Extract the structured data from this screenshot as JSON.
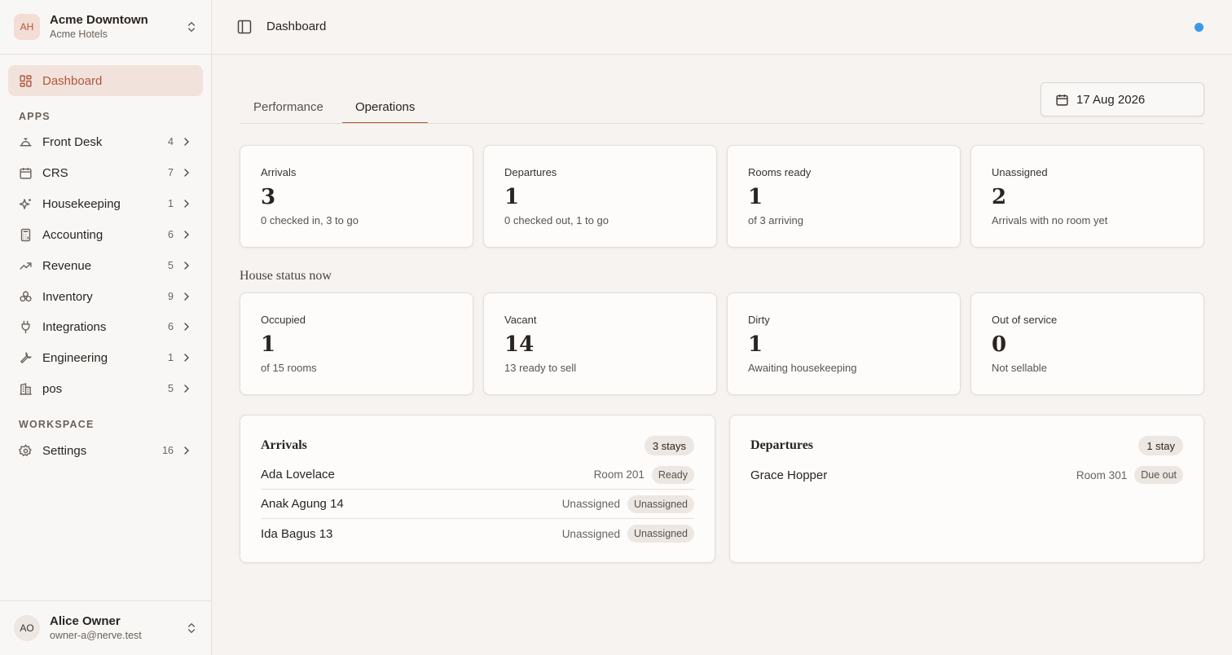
{
  "org": {
    "initials": "AH",
    "name": "Acme Downtown",
    "company": "Acme Hotels"
  },
  "nav": {
    "dashboard": "Dashboard",
    "apps_heading": "APPS",
    "apps": [
      {
        "label": "Front Desk",
        "count": "4",
        "icon": "bell-icon"
      },
      {
        "label": "CRS",
        "count": "7",
        "icon": "calendar-icon"
      },
      {
        "label": "Housekeeping",
        "count": "1",
        "icon": "sparkles-icon"
      },
      {
        "label": "Accounting",
        "count": "6",
        "icon": "calculator-icon"
      },
      {
        "label": "Revenue",
        "count": "5",
        "icon": "trending-up-icon"
      },
      {
        "label": "Inventory",
        "count": "9",
        "icon": "boxes-icon"
      },
      {
        "label": "Integrations",
        "count": "6",
        "icon": "plug-icon"
      },
      {
        "label": "Engineering",
        "count": "1",
        "icon": "wrench-icon"
      },
      {
        "label": "pos",
        "count": "5",
        "icon": "building-icon"
      }
    ],
    "workspace_heading": "WORKSPACE",
    "settings": {
      "label": "Settings",
      "count": "16",
      "icon": "gear-icon"
    }
  },
  "user": {
    "initials": "AO",
    "name": "Alice Owner",
    "email": "owner-a@nerve.test"
  },
  "topbar": {
    "breadcrumb": "Dashboard"
  },
  "tabs": [
    {
      "label": "Performance",
      "active": false
    },
    {
      "label": "Operations",
      "active": true
    }
  ],
  "date_picker": {
    "value": "17 Aug 2026"
  },
  "kpis": [
    {
      "title": "Arrivals",
      "value": "3",
      "sub": "0 checked in, 3 to go"
    },
    {
      "title": "Departures",
      "value": "1",
      "sub": "0 checked out, 1 to go"
    },
    {
      "title": "Rooms ready",
      "value": "1",
      "sub": "of 3 arriving"
    },
    {
      "title": "Unassigned",
      "value": "2",
      "sub": "Arrivals with no room yet"
    }
  ],
  "house_status": {
    "heading": "House status now",
    "cards": [
      {
        "title": "Occupied",
        "value": "1",
        "sub": "of 15 rooms"
      },
      {
        "title": "Vacant",
        "value": "14",
        "sub": "13 ready to sell"
      },
      {
        "title": "Dirty",
        "value": "1",
        "sub": "Awaiting housekeeping"
      },
      {
        "title": "Out of service",
        "value": "0",
        "sub": "Not sellable"
      }
    ]
  },
  "arrivals_panel": {
    "title": "Arrivals",
    "badge": "3 stays",
    "rows": [
      {
        "name": "Ada Lovelace",
        "room": "Room 201",
        "status": "Ready"
      },
      {
        "name": "Anak Agung 14",
        "room": "Unassigned",
        "status": "Unassigned"
      },
      {
        "name": "Ida Bagus 13",
        "room": "Unassigned",
        "status": "Unassigned"
      }
    ]
  },
  "departures_panel": {
    "title": "Departures",
    "badge": "1 stay",
    "rows": [
      {
        "name": "Grace Hopper",
        "room": "Room 301",
        "status": "Due out"
      }
    ]
  }
}
